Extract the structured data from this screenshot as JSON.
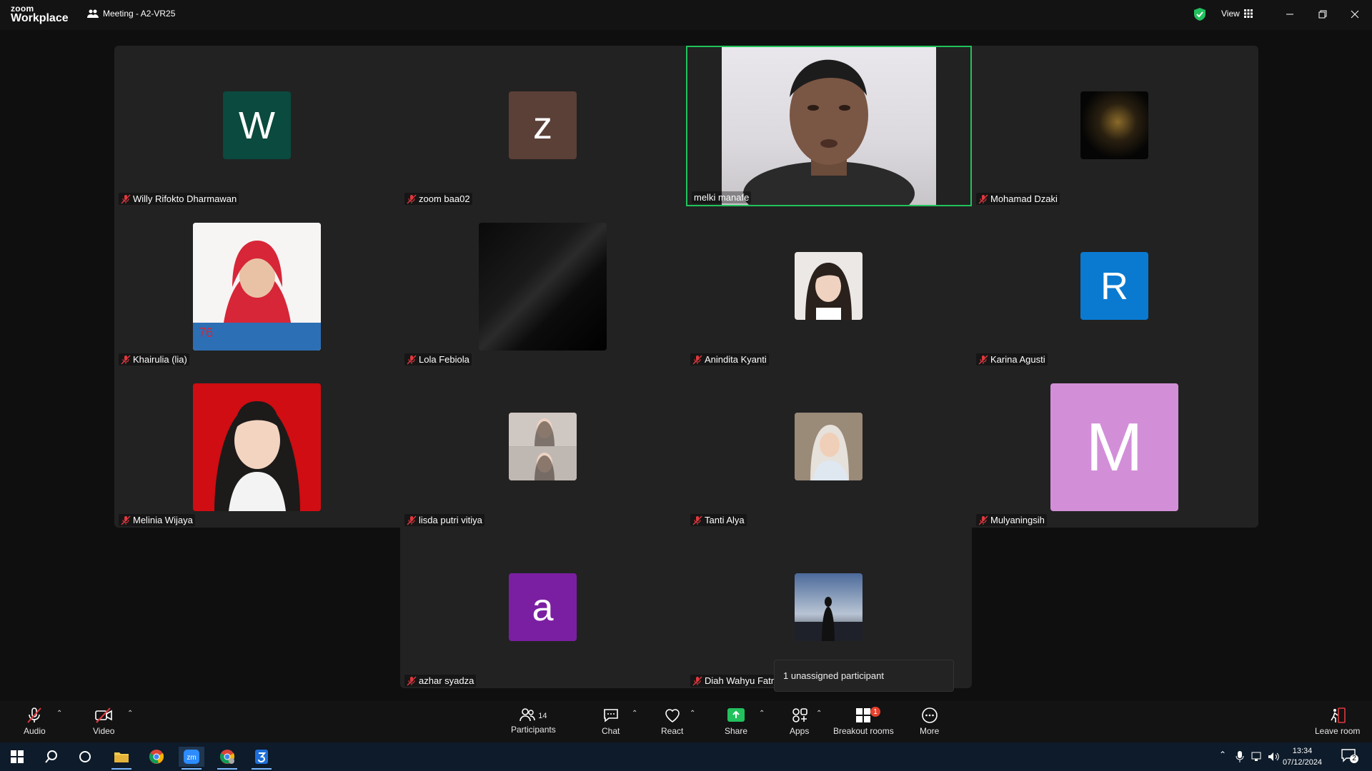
{
  "app": {
    "logo_line1": "zoom",
    "logo_line2": "Workplace",
    "meeting_title": "Meeting - A2-VR25",
    "view_label": "View"
  },
  "participants": [
    {
      "name": "Willy Rifokto Dharmawan",
      "avatar_type": "letter",
      "letter": "W",
      "color": "#0b4a3e"
    },
    {
      "name": "zoom baa02",
      "avatar_type": "letter",
      "letter": "z",
      "color": "#5b4037"
    },
    {
      "name": "melki manafe",
      "avatar_type": "video",
      "active_speaker": true
    },
    {
      "name": "Mohamad Dzaki",
      "avatar_type": "photo"
    },
    {
      "name": "Khairulia (lia)",
      "avatar_type": "photo"
    },
    {
      "name": "Lola Febiola",
      "avatar_type": "photo"
    },
    {
      "name": "Anindita Kyanti",
      "avatar_type": "photo"
    },
    {
      "name": "Karina Agusti",
      "avatar_type": "letter",
      "letter": "R",
      "color": "#0a7ad1"
    },
    {
      "name": "Melinia Wijaya",
      "avatar_type": "photo"
    },
    {
      "name": "lisda putri vitiya",
      "avatar_type": "photo"
    },
    {
      "name": "Tanti Alya",
      "avatar_type": "photo"
    },
    {
      "name": "Mulyaningsih",
      "avatar_type": "letter",
      "letter": "M",
      "color": "#d28fd8"
    },
    {
      "name": "azhar syadza",
      "avatar_type": "letter",
      "letter": "a",
      "color": "#7b1fa2"
    },
    {
      "name": "Diah Wahyu Fatm",
      "avatar_type": "photo"
    }
  ],
  "tooltip": "1 unassigned participant",
  "controls": {
    "audio": "Audio",
    "video": "Video",
    "participants": "Participants",
    "participants_count": "14",
    "chat": "Chat",
    "react": "React",
    "share": "Share",
    "apps": "Apps",
    "breakout": "Breakout rooms",
    "breakout_badge": "1",
    "more": "More",
    "leave": "Leave room"
  },
  "taskbar": {
    "time": "13:34",
    "date": "07/12/2024",
    "notif_count": "2"
  },
  "colors": {
    "active_speaker": "#21c35b",
    "share_green": "#22c15e",
    "mic_off_red": "#e0383e"
  }
}
